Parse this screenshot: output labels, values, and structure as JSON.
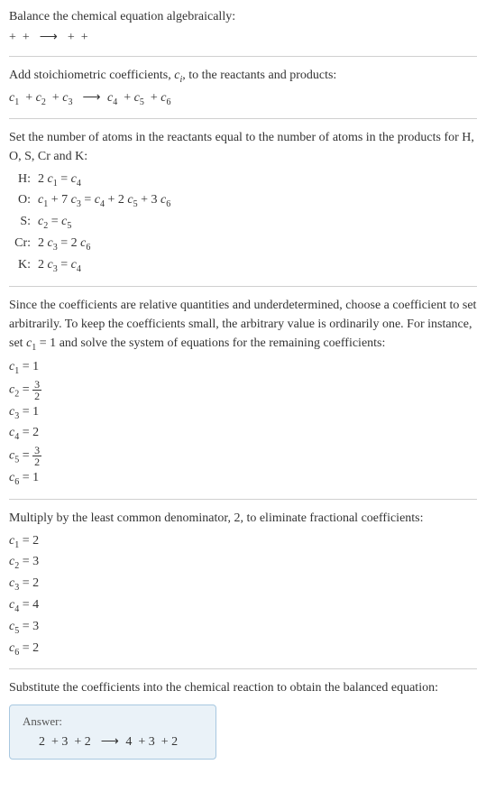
{
  "section1": {
    "title": "Balance the chemical equation algebraically:",
    "reaction": " +  +  ⟶  +  + "
  },
  "section2": {
    "title_a": "Add stoichiometric coefficients, ",
    "title_c": "c",
    "title_i": "i",
    "title_b": ", to the reactants and products:",
    "eq_parts": [
      "c",
      "1",
      "  + ",
      "c",
      "2",
      "  + ",
      "c",
      "3",
      "  ⟶ ",
      "c",
      "4",
      "  + ",
      "c",
      "5",
      "  + ",
      "c",
      "6"
    ]
  },
  "section3": {
    "title": "Set the number of atoms in the reactants equal to the number of atoms in the products for H, O, S, Cr and K:",
    "atoms": [
      {
        "label": "H:",
        "eq": "2 c₁ = c₄"
      },
      {
        "label": "O:",
        "eq": "c₁ + 7 c₃ = c₄ + 2 c₅ + 3 c₆"
      },
      {
        "label": "S:",
        "eq": "c₂ = c₅"
      },
      {
        "label": "Cr:",
        "eq": "2 c₃ = 2 c₆"
      },
      {
        "label": "K:",
        "eq": "2 c₃ = c₄"
      }
    ]
  },
  "section4": {
    "title_a": "Since the coefficients are relative quantities and underdetermined, choose a coefficient to set arbitrarily. To keep the coefficients small, the arbitrary value is ordinarily one. For instance, set ",
    "title_c": "c₁ = 1",
    "title_b": " and solve the system of equations for the remaining coefficients:",
    "coefs": [
      {
        "lhs": "c₁ = ",
        "val": "1",
        "frac": false
      },
      {
        "lhs": "c₂ = ",
        "num": "3",
        "den": "2",
        "frac": true
      },
      {
        "lhs": "c₃ = ",
        "val": "1",
        "frac": false
      },
      {
        "lhs": "c₄ = ",
        "val": "2",
        "frac": false
      },
      {
        "lhs": "c₅ = ",
        "num": "3",
        "den": "2",
        "frac": true
      },
      {
        "lhs": "c₆ = ",
        "val": "1",
        "frac": false
      }
    ]
  },
  "section5": {
    "title": "Multiply by the least common denominator, 2, to eliminate fractional coefficients:",
    "coefs": [
      {
        "lhs": "c₁ = ",
        "val": "2"
      },
      {
        "lhs": "c₂ = ",
        "val": "3"
      },
      {
        "lhs": "c₃ = ",
        "val": "2"
      },
      {
        "lhs": "c₄ = ",
        "val": "4"
      },
      {
        "lhs": "c₅ = ",
        "val": "3"
      },
      {
        "lhs": "c₆ = ",
        "val": "2"
      }
    ]
  },
  "section6": {
    "title": "Substitute the coefficients into the chemical reaction to obtain the balanced equation:",
    "answer_label": "Answer:",
    "answer_eq": "2  + 3  + 2  ⟶ 4  + 3  + 2 "
  }
}
